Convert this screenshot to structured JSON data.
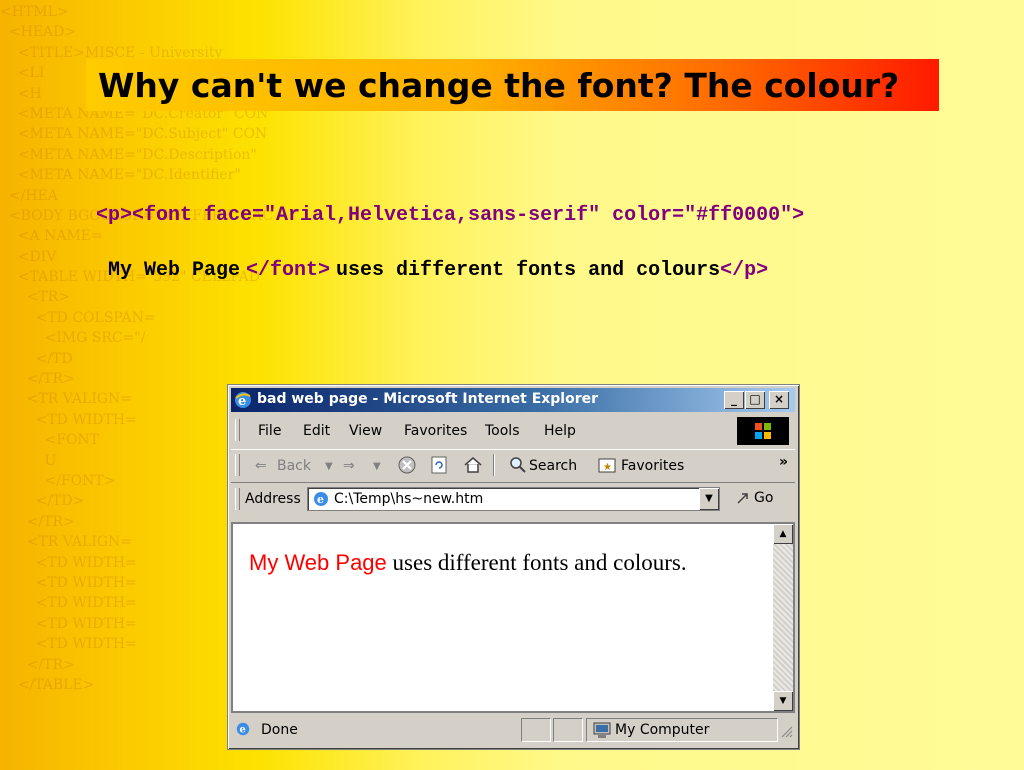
{
  "slide": {
    "title": "Why can't we change the font? The colour?",
    "code_line1": "<p><font face=\"Arial,Helvetica,sans-serif\" color=\"#ff0000\">",
    "code_line2_text1": "My Web Page",
    "code_line2_tag1": "</font>",
    "code_line2_text2": "uses different fonts and colours",
    "code_line2_tag2": "</p>",
    "colors": {
      "tag": "#800080",
      "title_gradient_end": "#ff1a00"
    }
  },
  "background_code": [
    "<HTML>",
    "  <HEAD>",
    "    <TITLE>MISCE - University",
    "    <LI",
    "    <H",
    "    <META NAME=\"DC.Creator\" CON",
    "    <META NAME=\"DC.Subject\" CON",
    "    <META NAME=\"DC.Description\"",
    "    <META NAME=\"DC.Identifier\"",
    "  </HEA",
    "  <BODY BGCOLOR=\"#FFFFFF\" BAC",
    "    <A NAME=",
    "    <DIV",
    "    <TABLE WIDTH=\"592\" CELLPAD",
    "      <TR>",
    "        <TD COLSPAN=",
    "          <IMG SRC=\"/",
    "        </TD",
    "      </TR>",
    "      <TR VALIGN=",
    "        <TD WIDTH=",
    "          <FONT",
    "          U",
    "          </FONT>",
    "        </TD>",
    "      </TR>",
    "      <TR VALIGN=",
    "        <TD WIDTH=",
    "        <TD WIDTH=",
    "        <TD WIDTH=",
    "        <TD WIDTH=",
    "        <TD WIDTH=",
    "      </TR>",
    "    </TABLE>"
  ],
  "browser": {
    "window_title": "bad web page - Microsoft Internet Explorer",
    "menu": [
      "File",
      "Edit",
      "View",
      "Favorites",
      "Tools",
      "Help"
    ],
    "toolbar": {
      "back": "Back",
      "search": "Search",
      "favorites": "Favorites",
      "more": "»"
    },
    "address_label": "Address",
    "address_value": "C:\\Temp\\hs~new.htm",
    "go_label": "Go",
    "page": {
      "red_text": "My Web Page",
      "rest_text": " uses different fonts and colours."
    },
    "status": {
      "left": "Done",
      "zone": "My Computer"
    }
  }
}
